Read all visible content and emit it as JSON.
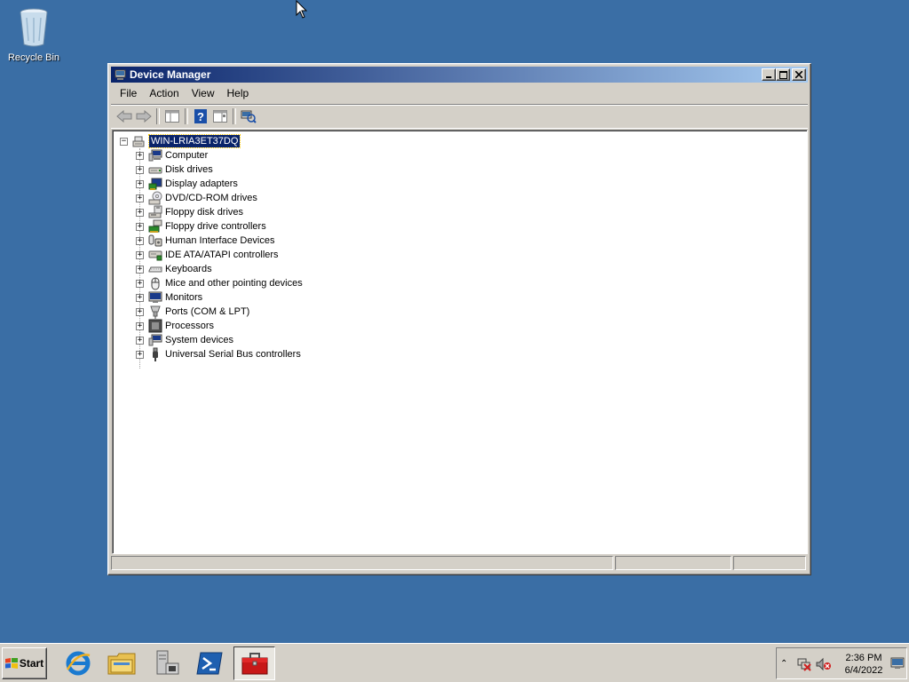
{
  "desktop": {
    "recycle_bin_label": "Recycle Bin"
  },
  "window": {
    "title": "Device Manager",
    "controls": {
      "minimize": "_",
      "maximize": "□",
      "close": "✕"
    },
    "menu": [
      "File",
      "Action",
      "View",
      "Help"
    ],
    "toolbar_icons": [
      "back-arrow-icon",
      "forward-arrow-icon",
      "show-hide-tree-icon",
      "help-icon",
      "properties-icon",
      "scan-hardware-icon"
    ],
    "tree": {
      "root": "WIN-LRIA3ET37DQ",
      "items": [
        {
          "label": "Computer",
          "icon": "computer-icon"
        },
        {
          "label": "Disk drives",
          "icon": "disk-drive-icon"
        },
        {
          "label": "Display adapters",
          "icon": "display-adapter-icon"
        },
        {
          "label": "DVD/CD-ROM drives",
          "icon": "dvd-drive-icon"
        },
        {
          "label": "Floppy disk drives",
          "icon": "floppy-drive-icon"
        },
        {
          "label": "Floppy drive controllers",
          "icon": "floppy-controller-icon"
        },
        {
          "label": "Human Interface Devices",
          "icon": "hid-icon"
        },
        {
          "label": "IDE ATA/ATAPI controllers",
          "icon": "ide-controller-icon"
        },
        {
          "label": "Keyboards",
          "icon": "keyboard-icon"
        },
        {
          "label": "Mice and other pointing devices",
          "icon": "mouse-icon"
        },
        {
          "label": "Monitors",
          "icon": "monitor-icon"
        },
        {
          "label": "Ports (COM & LPT)",
          "icon": "port-icon"
        },
        {
          "label": "Processors",
          "icon": "processor-icon"
        },
        {
          "label": "System devices",
          "icon": "system-device-icon"
        },
        {
          "label": "Universal Serial Bus controllers",
          "icon": "usb-icon"
        }
      ]
    }
  },
  "taskbar": {
    "start_label": "Start",
    "quick_launch": [
      "internet-explorer-icon",
      "windows-explorer-icon",
      "server-manager-icon",
      "powershell-icon"
    ],
    "active_task_icon": "device-manager-toolbox-icon",
    "clock": {
      "time": "2:36 PM",
      "date": "6/4/2022"
    }
  },
  "colors": {
    "desktop": "#3a6ea5",
    "title_active_start": "#0a246a",
    "title_active_end": "#a6caf0",
    "selection": "#0a246a",
    "chrome": "#d4d0c8"
  }
}
